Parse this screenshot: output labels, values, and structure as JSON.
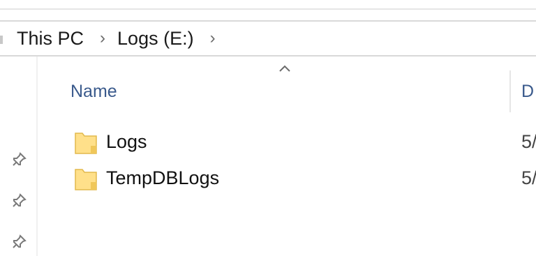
{
  "breadcrumb": {
    "items": [
      {
        "label": "This PC"
      },
      {
        "label": "Logs (E:)"
      }
    ],
    "separator": "›"
  },
  "columns": {
    "name": "Name",
    "date": "D",
    "sort": "ascending"
  },
  "files": [
    {
      "name": "Logs",
      "type": "folder",
      "date_fragment": "5/"
    },
    {
      "name": "TempDBLogs",
      "type": "folder",
      "date_fragment": "5/"
    }
  ],
  "nav_pane": {
    "pins": [
      "pin-icon",
      "pin-icon",
      "pin-icon"
    ]
  },
  "colors": {
    "header_text": "#3a5a8c",
    "folder_fill": "#ffe08a",
    "folder_edge": "#e2b94c"
  }
}
